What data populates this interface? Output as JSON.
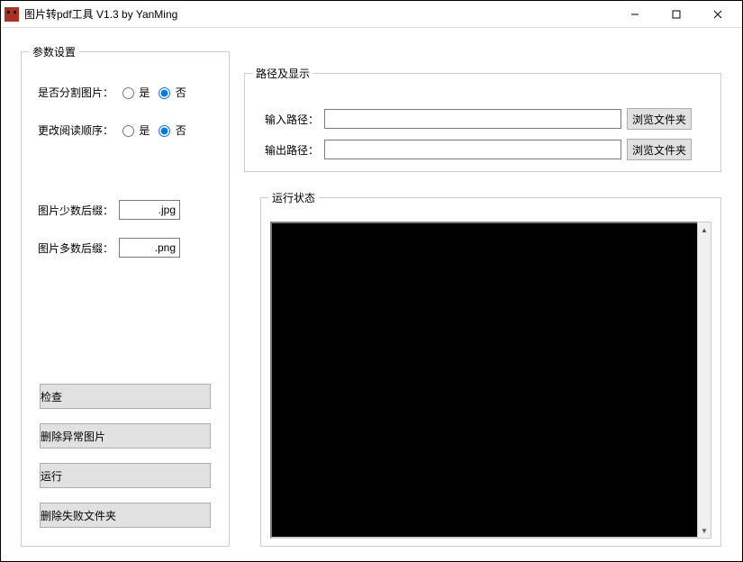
{
  "window": {
    "title": "图片转pdf工具 V1.3 by YanMing"
  },
  "groups": {
    "params": "参数设置",
    "paths": "路径及显示",
    "status": "运行状态"
  },
  "params": {
    "split_label": "是否分割图片：",
    "order_label": "更改阅读顺序：",
    "yes": "是",
    "no": "否",
    "split_selected": "no",
    "order_selected": "no",
    "minor_suffix_label": "图片少数后缀：",
    "minor_suffix_value": ".jpg",
    "major_suffix_label": "图片多数后缀：",
    "major_suffix_value": ".png"
  },
  "buttons": {
    "check": "检查",
    "del_abnormal": "删除异常图片",
    "run": "运行",
    "del_failed": "删除失败文件夹",
    "browse": "浏览文件夹"
  },
  "paths": {
    "input_label": "输入路径：",
    "input_value": "",
    "output_label": "输出路径：",
    "output_value": ""
  }
}
